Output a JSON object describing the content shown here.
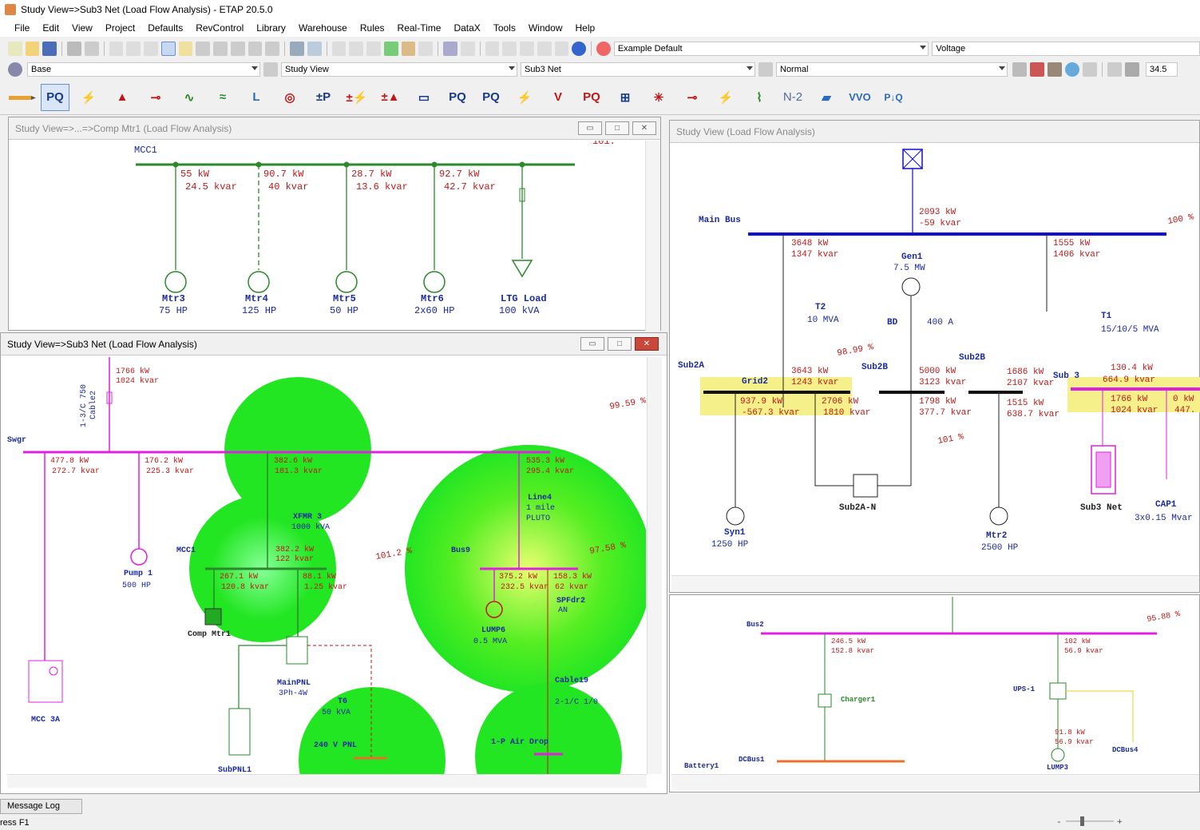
{
  "app": {
    "title": "Study View=>Sub3 Net (Load Flow Analysis) - ETAP 20.5.0"
  },
  "menu": [
    "File",
    "Edit",
    "View",
    "Project",
    "Defaults",
    "RevControl",
    "Library",
    "Warehouse",
    "Rules",
    "Real-Time",
    "DataX",
    "Tools",
    "Window",
    "Help"
  ],
  "toolbar": {
    "example_default": "Example Default",
    "voltage": "Voltage",
    "base": "Base",
    "study_view": "Study View",
    "sub3_net": "Sub3 Net",
    "normal": "Normal",
    "zoom_value": "34.5",
    "n2": "N-2",
    "vvo": "VVO"
  },
  "panel_mcc": {
    "title": "Study View=>...=>Comp Mtr1 (Load Flow Analysis)",
    "bus": "MCC1",
    "corner": "101.",
    "branches": [
      {
        "kw": "55 kW",
        "kvar": "24.5 kvar",
        "name": "Mtr3",
        "rating": "75 HP"
      },
      {
        "kw": "90.7 kW",
        "kvar": "40 kvar",
        "name": "Mtr4",
        "rating": "125 HP"
      },
      {
        "kw": "28.7 kW",
        "kvar": "13.6 kvar",
        "name": "Mtr5",
        "rating": "50 HP"
      },
      {
        "kw": "92.7 kW",
        "kvar": "42.7 kvar",
        "name": "Mtr6",
        "rating": "2x60 HP"
      },
      {
        "kw": "",
        "kvar": "",
        "name": "LTG Load",
        "rating": "100 kVA"
      }
    ]
  },
  "panel_sub3": {
    "title": "Study View=>Sub3 Net (Load Flow Analysis)",
    "labels": {
      "swgr": "Swgr",
      "cable2a": "1-3/C 750",
      "cable2b": "Cable2",
      "top_kw": "1766 kW",
      "top_kvar": "1024 kvar",
      "pct1": "99.59 %",
      "b1_kw": "477.8 kW",
      "b1_kvar": "272.7 kvar",
      "b2_kw": "176.2 kW",
      "b2_kvar": "225.3 kvar",
      "b3_kw": "382.6 kW",
      "b3_kvar": "181.3 kvar",
      "b4_kw": "535.3 kW",
      "b4_kvar": "295.4 kvar",
      "xfmr": "XFMR 3",
      "xfmr_kva": "1000 kVA",
      "mcc1": "MCC1",
      "x_kw": "382.2 kW",
      "x_kvar": "122 kvar",
      "m1_kw": "267.1 kW",
      "m1_kvar": "120.8 kvar",
      "m2_kw": "88.1 kW",
      "m2_kvar": "1.25 kvar",
      "pump": "Pump 1",
      "pump_hp": "500 HP",
      "comp": "Comp Mtr1",
      "mainpnl": "MainPNL",
      "mainpnl_sub": "3Ph-4W",
      "subpnl": "SubPNL1",
      "mcc3a": "MCC 3A",
      "t6": "T6",
      "t6_kva": "50 kVA",
      "pnl240": "240 V PNL",
      "pct2": "101.2 %",
      "line4a": "Line4",
      "line4b": "1 mile",
      "line4c": "PLUTO",
      "bus9": "Bus9",
      "pct3": "97.58 %",
      "l1_kw": "375.2 kW",
      "l1_kvar": "232.5 kvar",
      "l2_kw": "158.3 kW",
      "l2_kvar": "62 kvar",
      "spf": "SPFdr2",
      "spf2": "AN",
      "lump6": "LUMP6",
      "lump6_mva": "0.5 MVA",
      "cable19": "Cable19",
      "cable19b": "2-1/C 1/0",
      "airdrop": "1-P Air Drop"
    }
  },
  "panel_study": {
    "title": "Study View (Load Flow Analysis)",
    "labels": {
      "mainbus": "Main Bus",
      "pct100": "100 %",
      "g_kw": "2093 kW",
      "g_kvar": "-59 kvar",
      "a_kw": "3648 kW",
      "a_kvar": "1347 kvar",
      "gen1": "Gen1",
      "gen1_mw": "7.5 MW",
      "b_kw": "1555 kW",
      "b_kvar": "1406 kvar",
      "t2": "T2",
      "t2_mva": "10 MVA",
      "bd": "BD",
      "bd_a": "400 A",
      "t1": "T1",
      "t1_mva": "15/10/5 MVA",
      "pct9899": "98.99 %",
      "sub2a": "Sub2A",
      "grid2": "Grid2",
      "sub2b_l": "Sub2B",
      "sub2b_r": "Sub2B",
      "sub3": "Sub 3",
      "c_kw": "3643 kW",
      "c_kvar": "1243 kvar",
      "d_kw": "5000 kW",
      "d_kvar": "3123 kvar",
      "e_kw": "1686 kW",
      "e_kvar": "2107 kvar",
      "f_kw": "130.4 kW",
      "f_kvar": "664.9 kvar",
      "h_kw": "937.9 kW",
      "h_kvar": "-567.3 kvar",
      "i_kw": "2706 kW",
      "i_kvar": "1810 kvar",
      "j_kw": "1798 kW",
      "j_kvar": "377.7 kvar",
      "k_kw": "1515 kW",
      "k_kvar": "638.7 kvar",
      "l_kw": "1766 kW",
      "l_kvar": "1024 kvar",
      "m_kw": "0 kW",
      "m_kvar": "447.",
      "pct101": "101 %",
      "sub2an": "Sub2A-N",
      "syn1": "Syn1",
      "syn1_hp": "1250 HP",
      "mtr2": "Mtr2",
      "mtr2_hp": "2500 HP",
      "sub3net": "Sub3 Net",
      "cap1": "CAP1",
      "cap1_mvar": "3x0.15 Mvar"
    }
  },
  "panel_dc": {
    "labels": {
      "bus2": "Bus2",
      "pct": "95.88 %",
      "a_kw": "246.5 kW",
      "a_kvar": "152.8 kvar",
      "b_kw": "102 kW",
      "b_kvar": "56.9 kvar",
      "charger": "Charger1",
      "ups": "UPS-1",
      "c_kw": "91.8 kW",
      "c_kvar": "56.9 kvar",
      "lump3": "LUMP3",
      "dcbus4": "DCBus4",
      "dcbus1": "DCBus1",
      "battery": "Battery1"
    }
  },
  "status": {
    "message_log": "Message Log",
    "help": "ress F1"
  },
  "colors": {
    "green_bus": "#2a8a2a",
    "magenta_bus": "#e020e0",
    "blue_bus": "#1010d0",
    "flow_red": "#c01818",
    "label_blue": "#1a2aa0",
    "alert_yellow": "#f6f08a",
    "halo_green": "#22e622"
  }
}
